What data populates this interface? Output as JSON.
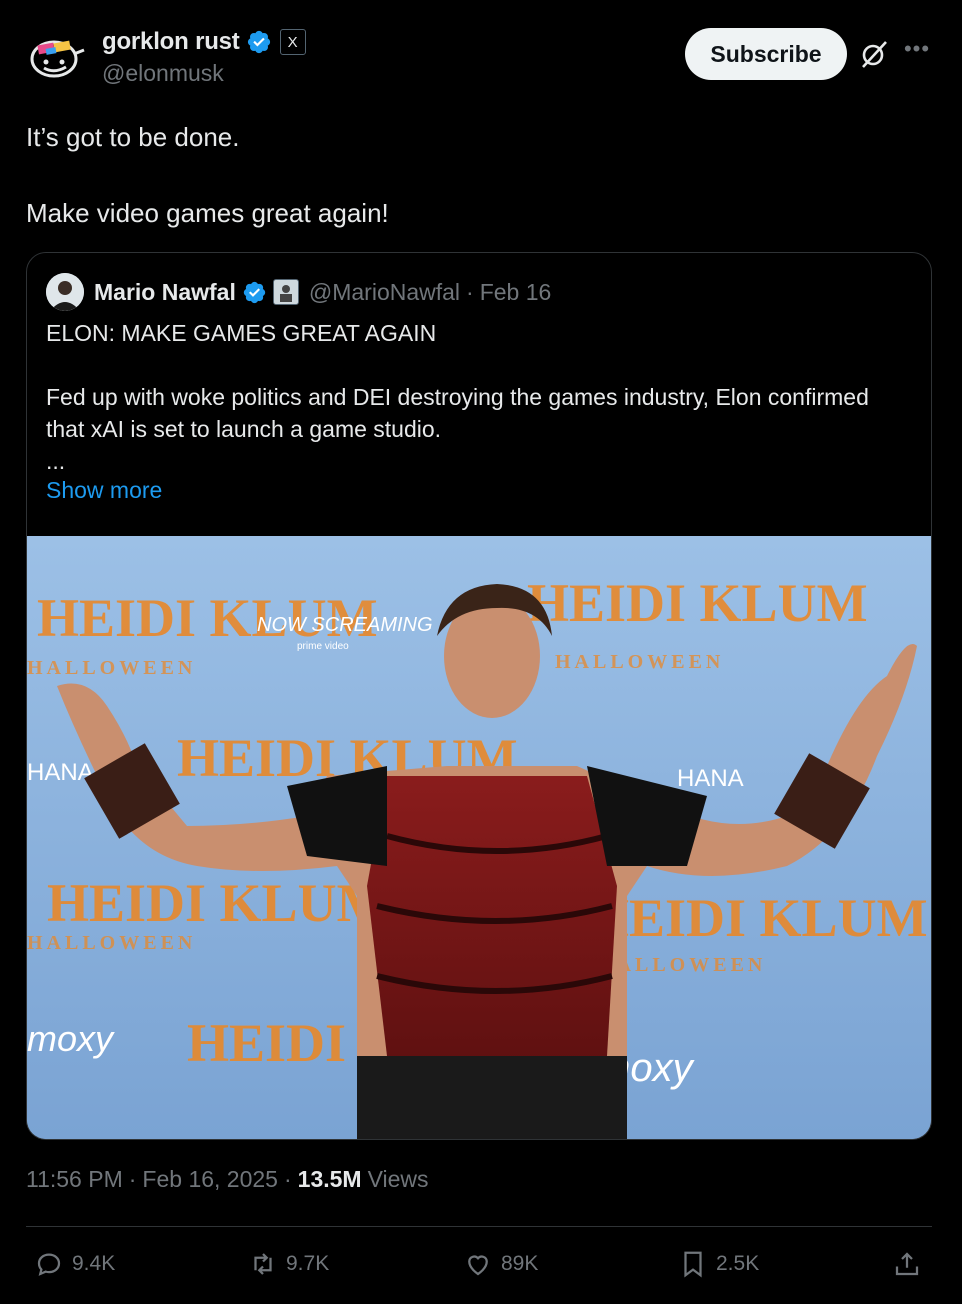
{
  "author": {
    "display_name": "gorklon rust",
    "handle": "@elonmusk",
    "verified": true,
    "affiliate_badge": "X"
  },
  "header": {
    "subscribe_label": "Subscribe",
    "grok_icon": "grok-icon",
    "more_icon": "more-icon"
  },
  "tweet": {
    "lines": [
      "It’s got to be done.",
      "Make video games great again!"
    ]
  },
  "quote": {
    "display_name": "Mario Nawfal",
    "handle": "@MarioNawfal",
    "separator": "·",
    "date": "Feb 16",
    "headline": "ELON: MAKE GAMES GREAT AGAIN",
    "body": "Fed up with woke politics and DEI destroying the games industry, Elon confirmed that xAI is set to launch a game studio.",
    "ellipsis": "...",
    "show_more": "Show more",
    "photo_texts": {
      "backdrop_brand": "HEIDI KLUM",
      "backdrop_sub": "HALLOWEEN",
      "sponsor": "NOW SCREAMING",
      "sponsor_sub": "prime video",
      "venue": "moxy",
      "hana": "HANA"
    }
  },
  "meta": {
    "time": "11:56 PM",
    "sep1": "·",
    "date": "Feb 16, 2025",
    "sep2": "·",
    "views_count": "13.5M",
    "views_label": "Views"
  },
  "actions": {
    "replies": "9.4K",
    "reposts": "9.7K",
    "likes": "89K",
    "bookmarks": "2.5K"
  },
  "colors": {
    "background": "#000000",
    "text": "#e7e9ea",
    "secondary": "#71767b",
    "link": "#1d9bf0",
    "verified": "#1d9bf0",
    "border": "#2f3336"
  }
}
